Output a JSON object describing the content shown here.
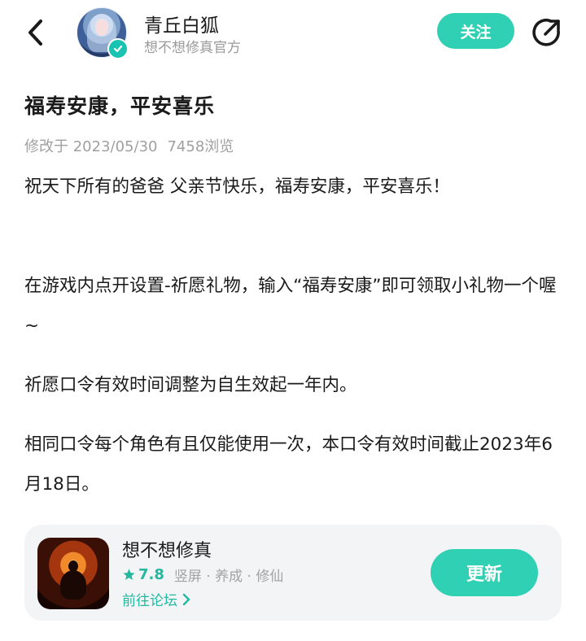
{
  "header": {
    "author_name": "青丘白狐",
    "author_subtitle": "想不想修真官方",
    "follow_label": "关注"
  },
  "article": {
    "title": "福寿安康，平安喜乐",
    "modified_label": "修改于 2023/05/30",
    "views": "7458浏览",
    "paragraphs": [
      "祝天下所有的爸爸 父亲节快乐，福寿安康，平安喜乐！",
      "在游戏内点开设置-祈愿礼物，输入“福寿安康”即可领取小礼物一个喔~",
      "祈愿口令有效时间调整为自生效起一年内。",
      "相同口令每个角色有且仅能使用一次，本口令有效时间截止2023年6月18日。"
    ]
  },
  "game_card": {
    "name": "想不想修真",
    "rating": "7.8",
    "tags": "竖屏 · 养成 · 修仙",
    "forum_link": "前往论坛",
    "update_label": "更新"
  },
  "icons": {
    "back": "chevron-left-icon",
    "share": "share-icon",
    "verified": "verified-check-icon",
    "star": "star-icon",
    "forum_arrow": "chevron-right-icon"
  },
  "colors": {
    "accent": "#2fd0b4",
    "accent_text": "#23b89f",
    "meta_text": "#a0a0a0",
    "card_bg": "#f3f4f6"
  }
}
